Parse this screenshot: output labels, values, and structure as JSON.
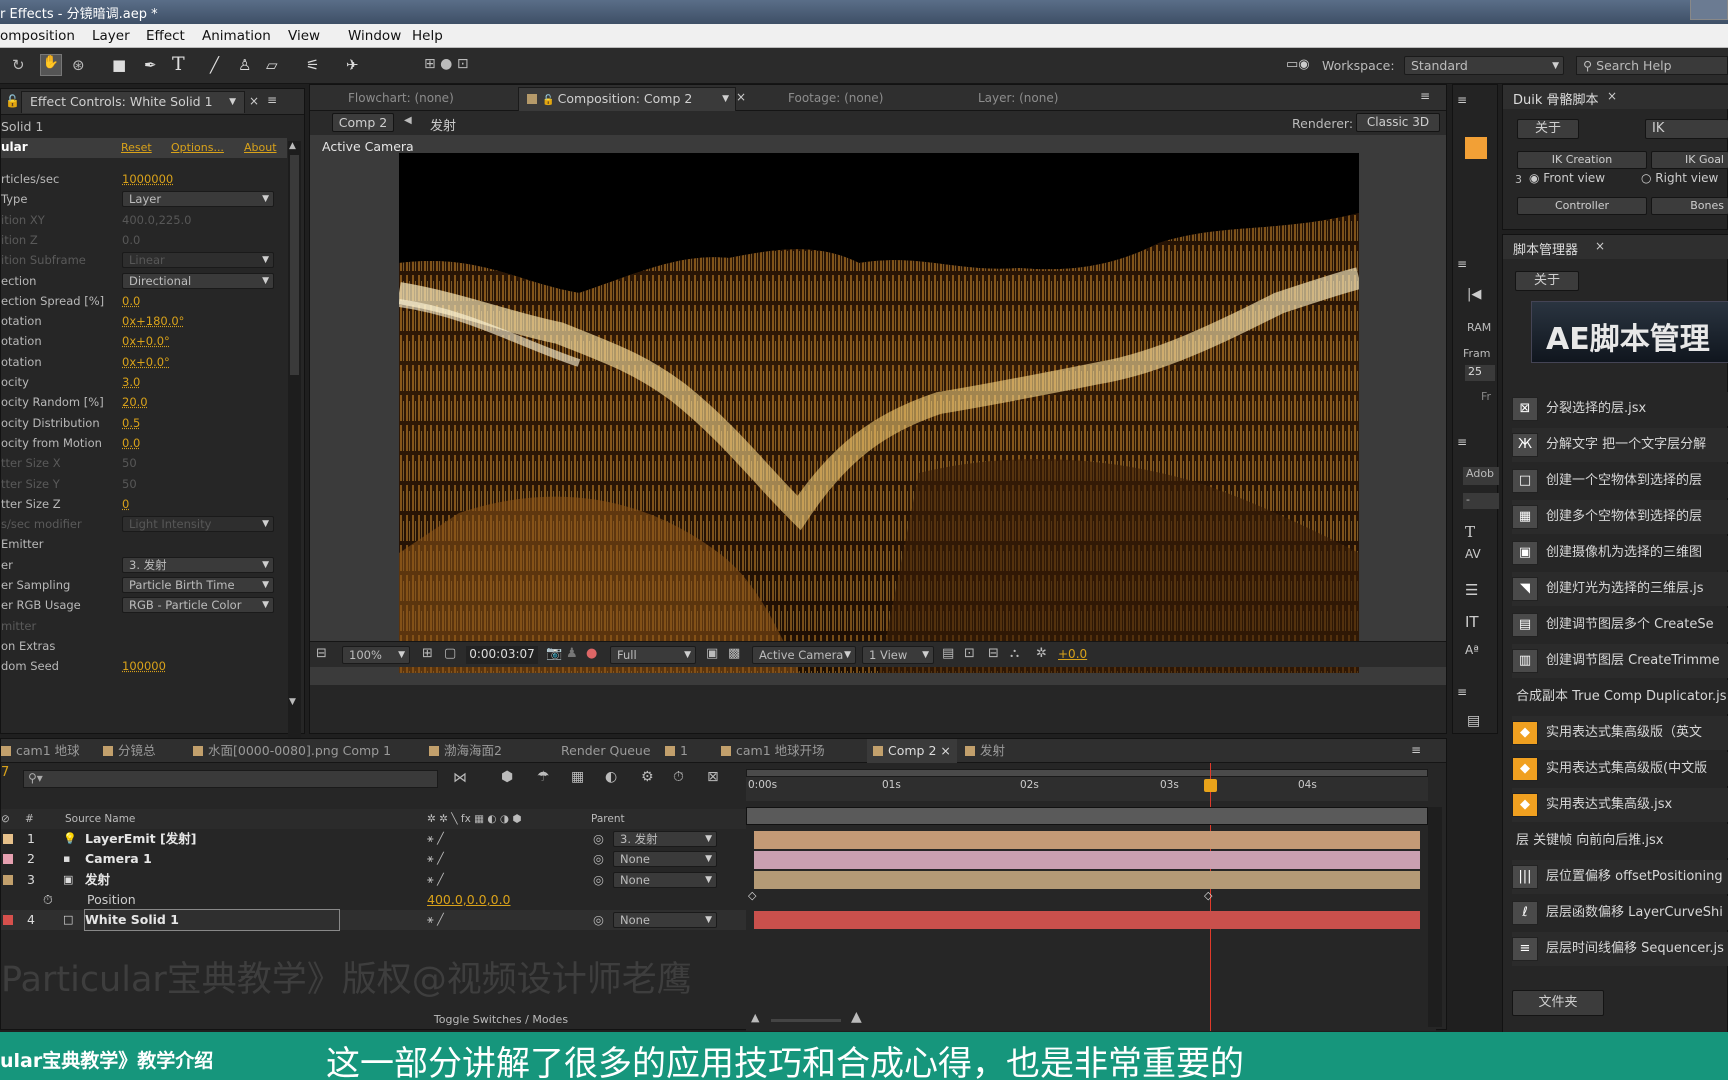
{
  "window": {
    "title": "r Effects - 分镜暗调.aep *"
  },
  "menu": [
    "omposition",
    "Layer",
    "Effect",
    "Animation",
    "View",
    "Window",
    "Help"
  ],
  "toolbar": {
    "workspace_label": "Workspace:",
    "workspace_value": "Standard",
    "search_placeholder": "Search Help"
  },
  "effect_controls": {
    "tab": "Effect Controls: White Solid 1",
    "layer": "Solid 1",
    "effect": "ular",
    "reset": "Reset",
    "options": "Options...",
    "about": "About",
    "rows": [
      {
        "label": "rticles/sec",
        "value": "1000000",
        "kind": "orange"
      },
      {
        "label": "Type",
        "value": "Layer",
        "kind": "dd"
      },
      {
        "label": "ition XY",
        "value": "400.0,225.0",
        "kind": "dim"
      },
      {
        "label": "ition Z",
        "value": "0.0",
        "kind": "dim"
      },
      {
        "label": "ition Subframe",
        "value": "Linear",
        "kind": "dimdd"
      },
      {
        "label": "ection",
        "value": "Directional",
        "kind": "dd"
      },
      {
        "label": "ection Spread [%]",
        "value": "0.0",
        "kind": "orange"
      },
      {
        "label": "otation",
        "value": "0x+180.0°",
        "kind": "orange"
      },
      {
        "label": "otation",
        "value": "0x+0.0°",
        "kind": "orange"
      },
      {
        "label": "otation",
        "value": "0x+0.0°",
        "kind": "orange"
      },
      {
        "label": "ocity",
        "value": "3.0",
        "kind": "orange"
      },
      {
        "label": "ocity Random [%]",
        "value": "20.0",
        "kind": "orange"
      },
      {
        "label": "ocity Distribution",
        "value": "0.5",
        "kind": "orange"
      },
      {
        "label": "ocity from Motion",
        "value": "0.0",
        "kind": "orange"
      },
      {
        "label": "tter Size X",
        "value": "50",
        "kind": "dim"
      },
      {
        "label": "tter Size Y",
        "value": "50",
        "kind": "dim"
      },
      {
        "label": "tter Size Z",
        "value": "0",
        "kind": "orange"
      },
      {
        "label": "s/sec modifier",
        "value": "Light Intensity",
        "kind": "dimdd"
      },
      {
        "label": "Emitter",
        "value": "",
        "kind": "head"
      },
      {
        "label": "er",
        "value": "3. 发射",
        "kind": "dd"
      },
      {
        "label": "er Sampling",
        "value": "Particle Birth Time",
        "kind": "dd"
      },
      {
        "label": "er RGB Usage",
        "value": "RGB - Particle Color",
        "kind": "dd"
      },
      {
        "label": "mitter",
        "value": "",
        "kind": "dimhead"
      },
      {
        "label": "on Extras",
        "value": "",
        "kind": "head"
      },
      {
        "label": "dom Seed",
        "value": "100000",
        "kind": "orange"
      }
    ]
  },
  "viewer_tabs": {
    "flowchart": "Flowchart: (none)",
    "composition": "Composition: Comp 2",
    "footage": "Footage: (none)",
    "layer": "Layer: (none)"
  },
  "viewer": {
    "crumb1": "Comp 2",
    "crumb2": "发射",
    "renderer_label": "Renderer:",
    "renderer_value": "Classic 3D",
    "camera_label": "Active Camera",
    "zoom": "100%",
    "time": "0:00:03:07",
    "resolution": "Full",
    "camera": "Active Camera",
    "views": "1 View",
    "exposure": "+0.0"
  },
  "timeline": {
    "tabs": [
      "cam1 地球",
      "分镜总",
      "水面[0000-0080].png Comp 1",
      "渤海海面2",
      "Render Queue",
      "1",
      "cam1 地球开场",
      "Comp 2",
      "发射"
    ],
    "col_num": "#",
    "col_source": "Source Name",
    "col_parent": "Parent",
    "ruler": [
      "0:00s",
      "01s",
      "02s",
      "03s",
      "04s"
    ],
    "layers": [
      {
        "num": "1",
        "name": "LayerEmit [发射]",
        "parent": "3. 发射"
      },
      {
        "num": "2",
        "name": "Camera 1",
        "parent": "None"
      },
      {
        "num": "3",
        "name": "发射",
        "parent": "None"
      },
      {
        "num": "",
        "name": "Position",
        "parent": "",
        "value": "400.0,0.0,0.0"
      },
      {
        "num": "4",
        "name": "White Solid 1",
        "parent": "None"
      }
    ],
    "toggle": "Toggle Switches / Modes"
  },
  "duik": {
    "tab": "Duik 骨骼脚本",
    "about": "关于",
    "ik": "IK",
    "ik_creation": "IK Creation",
    "ik_goal": "IK Goal",
    "front_view": "Front view",
    "right_view": "Right view",
    "controller": "Controller",
    "bones": "Bones",
    "num": "3"
  },
  "scripts": {
    "tab": "脚本管理器",
    "about": "关于",
    "banner": "AE脚本管理",
    "files": "文件夹",
    "items": [
      {
        "icon": "⊠",
        "text": "分裂选择的层.jsx"
      },
      {
        "icon": "Ж",
        "text": "分解文字 把一个文字层分解"
      },
      {
        "icon": "□",
        "text": "创建一个空物体到选择的层"
      },
      {
        "icon": "▦",
        "text": "创建多个空物体到选择的层"
      },
      {
        "icon": "▣",
        "text": "创建摄像机为选择的三维图"
      },
      {
        "icon": "◥",
        "text": "创建灯光为选择的三维层.js"
      },
      {
        "icon": "▤",
        "text": "创建调节图层多个 CreateSe"
      },
      {
        "icon": "▥",
        "text": "创建调节图层 CreateTrimme"
      },
      {
        "icon": "",
        "text": "合成副本 True Comp Duplicator.js"
      },
      {
        "icon": "◆",
        "text": "实用表达式集高级版（英文"
      },
      {
        "icon": "◆",
        "text": "实用表达式集高级版(中文版"
      },
      {
        "icon": "◆",
        "text": "实用表达式集高级.jsx"
      },
      {
        "icon": "",
        "text": "层 关键帧 向前向后推.jsx"
      },
      {
        "icon": "|||",
        "text": "层位置偏移 offsetPositioning"
      },
      {
        "icon": "ℓ",
        "text": "层层函数偏移 LayerCurveShi"
      },
      {
        "icon": "≡",
        "text": "层层时间线偏移 Sequencer.js"
      }
    ]
  },
  "side_strip": {
    "ram": "RAM",
    "fram": "Fram",
    "fps": "25",
    "fr": "Fr",
    "adob": "Adob"
  },
  "watermark": "Particular宝典教学》版权@视频设计师老鹰",
  "subtitle": {
    "left": "ular宝典教学》教学介绍",
    "main": "这一部分讲解了很多的应用技巧和合成心得，也是非常重要的"
  }
}
